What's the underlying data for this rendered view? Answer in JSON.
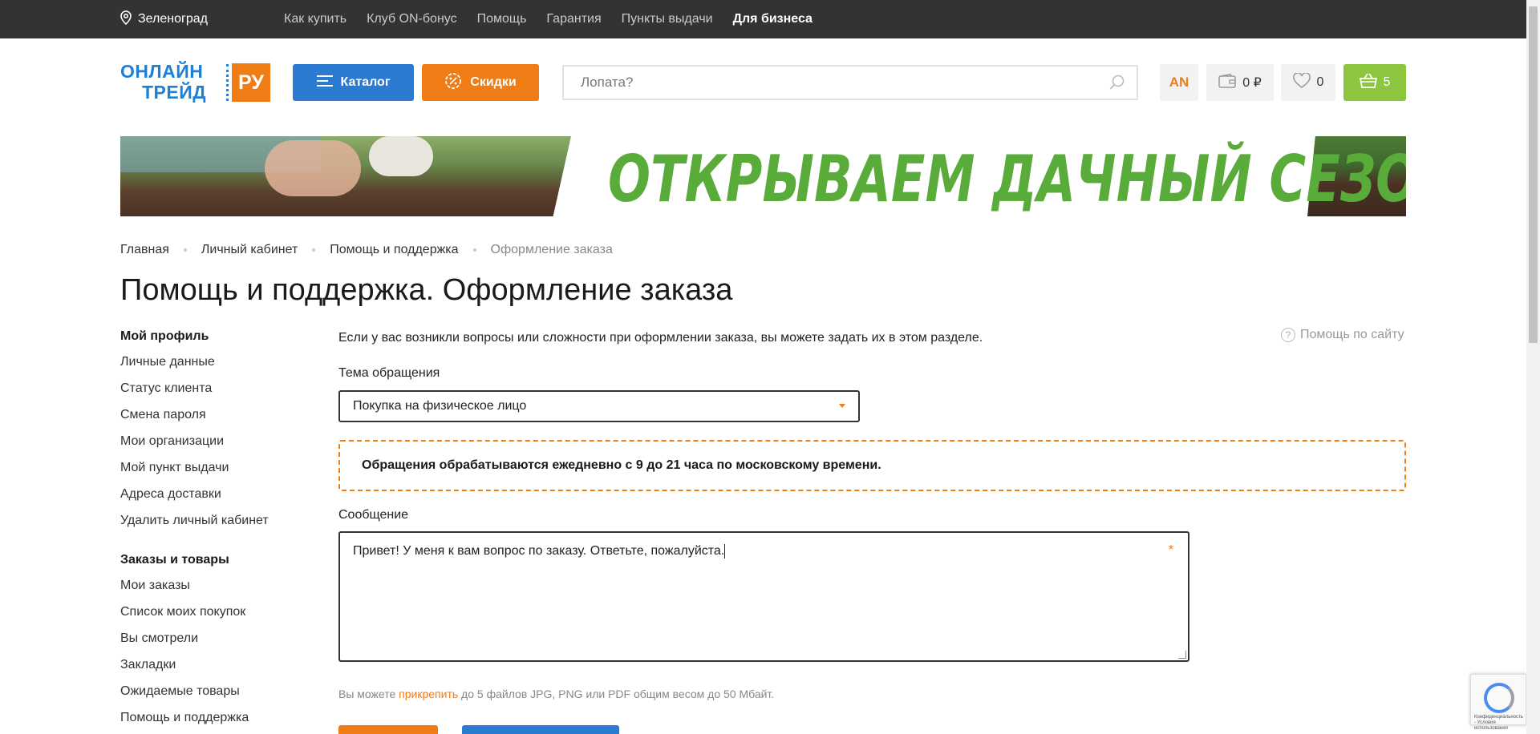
{
  "topbar": {
    "city": "Зеленоград",
    "nav": [
      "Как купить",
      "Клуб ON-бонус",
      "Помощь",
      "Гарантия",
      "Пункты выдачи"
    ],
    "business": "Для бизнеса"
  },
  "logo": {
    "line1": "ОНЛАЙН",
    "line2": "ТРЕЙД",
    "ru": "РУ"
  },
  "header": {
    "catalog_label": "Каталог",
    "sale_label": "Скидки",
    "search_placeholder": "Лопата?",
    "account_initials": "AN",
    "wallet_amount": "0 ₽",
    "favorites_count": "0",
    "cart_count": "5"
  },
  "banner": {
    "title": "ОТКРЫВАЕМ ДАЧНЫЙ СЕЗОН"
  },
  "breadcrumbs": [
    "Главная",
    "Личный кабинет",
    "Помощь и поддержка",
    "Оформление заказа"
  ],
  "page_title": "Помощь и поддержка. Оформление заказа",
  "sidebar": {
    "profile_heading": "Мой профиль",
    "profile_items": [
      "Личные данные",
      "Статус клиента",
      "Смена пароля",
      "Мои организации",
      "Мой пункт выдачи",
      "Адреса доставки",
      "Удалить личный кабинет"
    ],
    "orders_heading": "Заказы и товары",
    "orders_items": [
      "Мои заказы",
      "Список моих покупок",
      "Вы смотрели",
      "Закладки",
      "Ожидаемые товары",
      "Помощь и поддержка"
    ]
  },
  "main": {
    "intro": "Если у вас возникли вопросы или сложности при оформлении заказа, вы можете задать их в этом разделе.",
    "help_link": "Помощь по сайту",
    "topic_label": "Тема обращения",
    "topic_value": "Покупка на физическое лицо",
    "notice": "Обращения обрабатываются ежедневно с 9 до 21 часа по московскому времени.",
    "message_label": "Сообщение",
    "message_value": "Привет! У меня к вам вопрос по заказу. Ответьте, пожалуйста.",
    "required_mark": "*",
    "attach_before": "Вы можете ",
    "attach_link": "прикрепить",
    "attach_after": " до 5 файлов JPG, PNG или PDF общим весом до 50 Мбайт."
  },
  "recaptcha": {
    "text": "Конфиденциальность - Условия использования"
  },
  "colors": {
    "accent_orange": "#f07c15",
    "brand_blue": "#2a7bd1",
    "cart_green": "#8cc63f",
    "topbar": "#333333",
    "banner_green": "#59ac3a"
  }
}
